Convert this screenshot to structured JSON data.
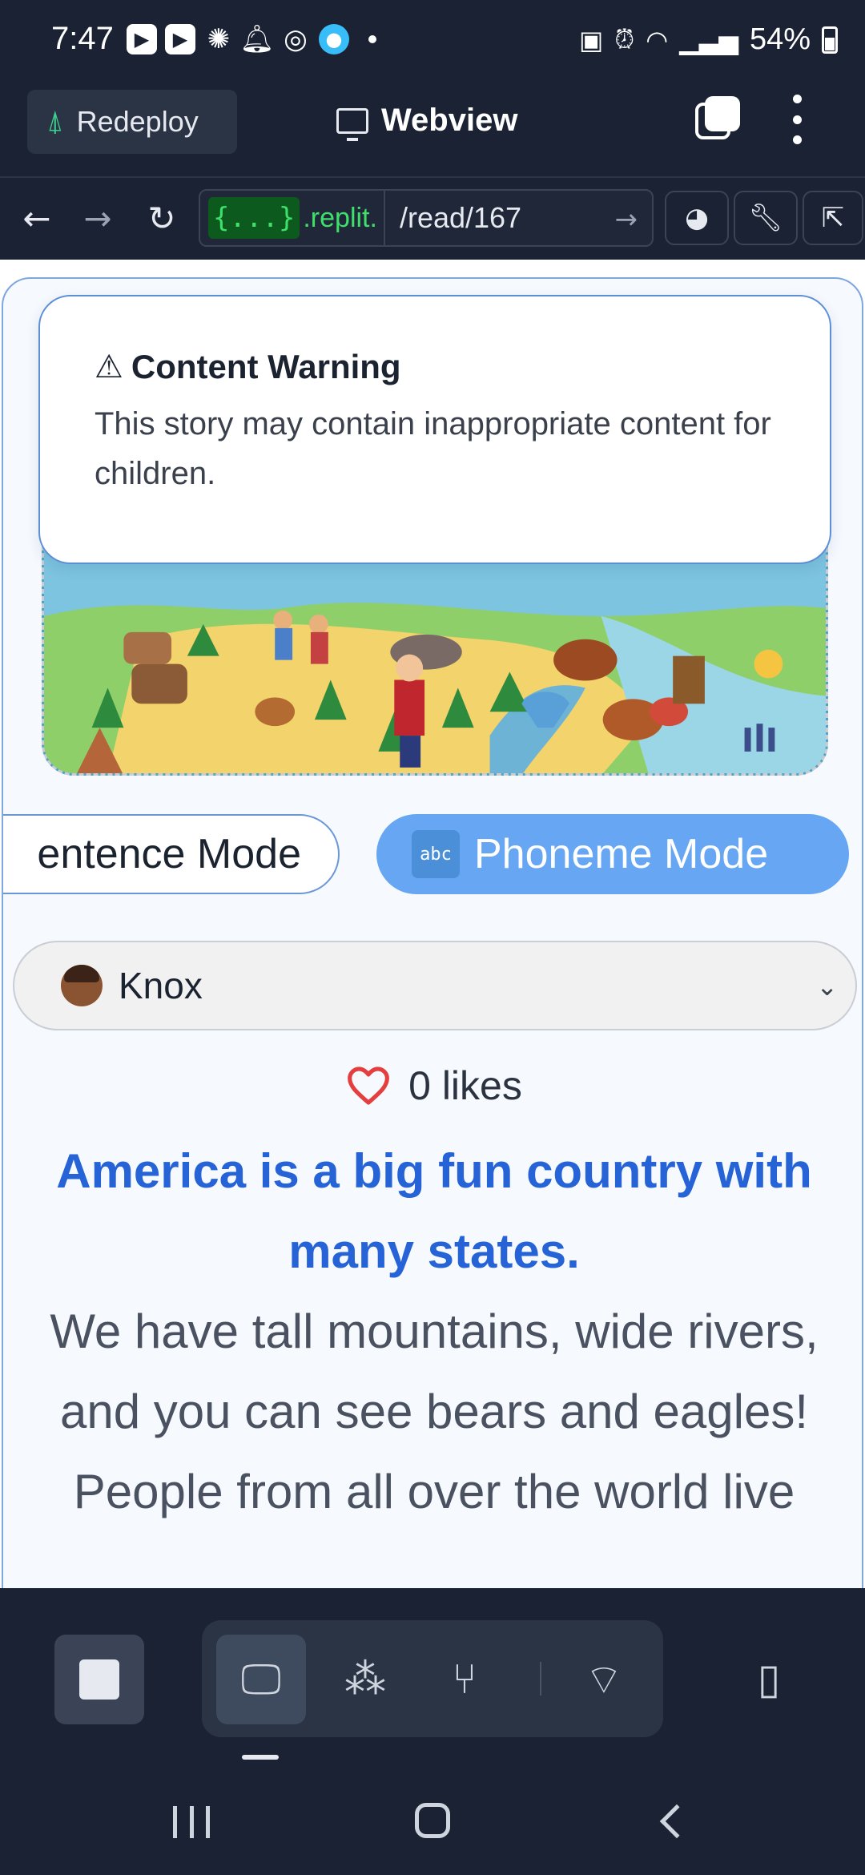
{
  "status_bar": {
    "time": "7:47",
    "battery": "54%"
  },
  "header": {
    "redeploy_label": "Redeploy",
    "title": "Webview"
  },
  "url_bar": {
    "host_badge": "{...}",
    "host": ".replit.",
    "path": "/read/167"
  },
  "warning": {
    "title": "Content Warning",
    "text": "This story may contain inappropriate content for children."
  },
  "modes": {
    "sentence_label": "entence Mode",
    "phoneme_icon": "abc",
    "phoneme_label": "Phoneme Mode"
  },
  "reader": {
    "selected": "Knox"
  },
  "likes": {
    "text": "0 likes"
  },
  "story": {
    "active_sentence": "America is a big fun country with many states.",
    "sentences": [
      "We have tall mountains, wide rivers, and you can see bears and eagles!",
      "People from all over the world live"
    ]
  },
  "colors": {
    "accent": "#2563d6",
    "phoneme_button": "#66a6f2",
    "chrome": "#1b2233",
    "heart": "#e53e3e"
  }
}
